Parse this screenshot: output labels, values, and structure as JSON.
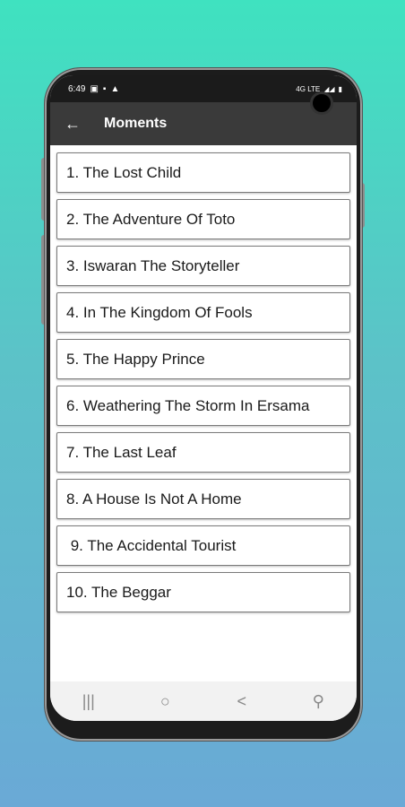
{
  "status": {
    "time": "6:49",
    "left_icons": [
      "image-icon",
      "dot-icon",
      "warning-icon"
    ],
    "right_text": "4G LTE",
    "battery": "battery-icon"
  },
  "appbar": {
    "title": "Moments",
    "back_icon": "arrow-left-icon"
  },
  "chapters": [
    "1. The Lost Child",
    "2. The Adventure Of Toto",
    "3. Iswaran The Storyteller",
    "4. In The Kingdom Of Fools",
    "5. The Happy Prince",
    "6. Weathering The Storm In Ersama",
    "7. The Last Leaf",
    "8. A House Is Not A Home",
    " 9. The Accidental Tourist",
    "10. The Beggar"
  ],
  "navbar": {
    "recents": "|||",
    "home": "○",
    "back": "<",
    "accessibility": "⚲"
  },
  "colors": {
    "appbar": "#3a3a3a",
    "statusbar": "#1b1b1b",
    "background_top": "#3fe2c0",
    "background_bottom": "#6aa9d6"
  }
}
